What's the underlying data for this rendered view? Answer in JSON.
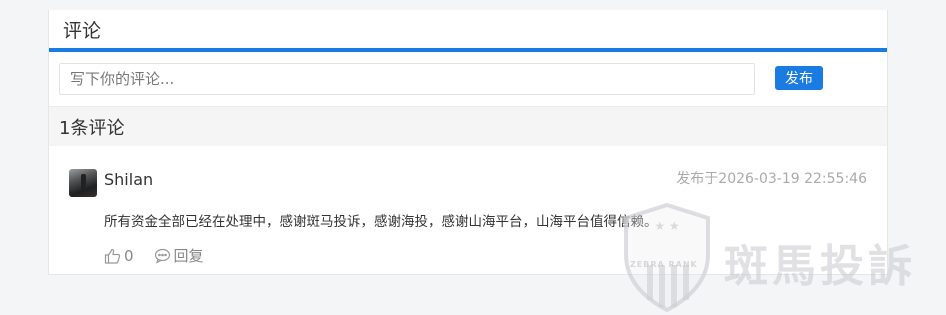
{
  "section_title": "评论",
  "compose": {
    "placeholder": "写下你的评论...",
    "publish_label": "发布"
  },
  "comment_count_label": "1条评论",
  "comments": [
    {
      "username": "Shilan",
      "timestamp": "发布于2026-03-19 22:55:46",
      "body": "所有资金全部已经在处理中，感谢斑马投诉，感谢海投，感谢山海平台，山海平台值得信赖。",
      "like_count": "0",
      "reply_label": "回复"
    }
  ],
  "watermark": {
    "brand_text": "斑馬投訴",
    "badge_text": "ZEBRA RANK"
  },
  "colors": {
    "accent": "#1a7be0",
    "background": "#f4f5f7"
  }
}
